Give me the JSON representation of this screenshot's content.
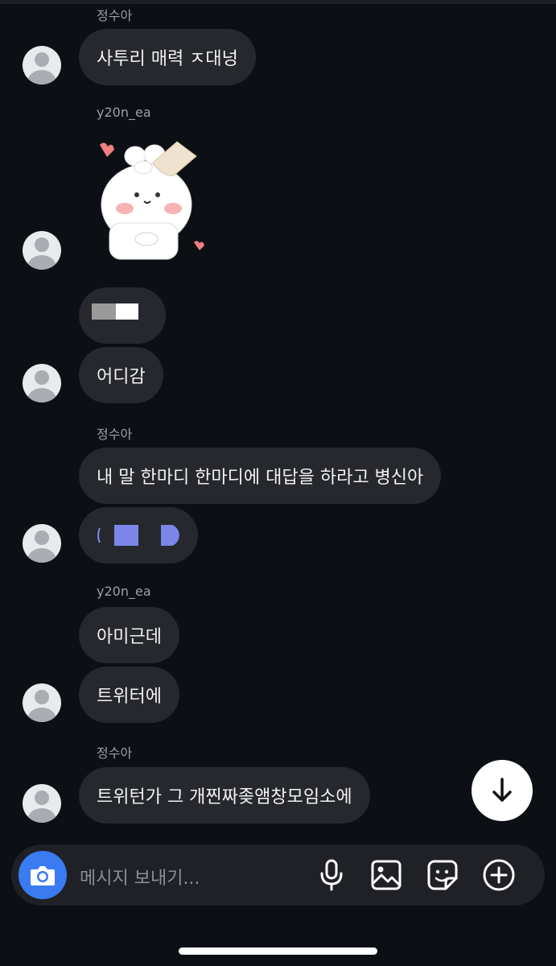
{
  "messages": [
    {
      "sender": "정수아",
      "texts": [
        "사투리 매력 ㅈ대넝"
      ]
    },
    {
      "sender": "y20n_ea",
      "sticker": "bunny-sticker",
      "texts": [
        "어디감"
      ]
    },
    {
      "sender": "정수아",
      "texts": [
        "내 말 한마디 한마디에 대답을 하라고 병신아"
      ]
    },
    {
      "sender": "y20n_ea",
      "texts": [
        "아미근데",
        "트위터에"
      ]
    },
    {
      "sender": "정수아",
      "texts": [
        "트위턴가 그 개찐짜좆앰창모임소에"
      ]
    }
  ],
  "composer": {
    "placeholder": "메시지 보내기..."
  },
  "icons": {
    "camera": "camera-icon",
    "mic": "microphone-icon",
    "gallery": "image-icon",
    "sticker": "sticker-icon",
    "plus": "plus-circle-icon",
    "scroll": "arrow-down-icon"
  },
  "colors": {
    "background": "#0c0f14",
    "bubble": "#26282e",
    "accent": "#3a7bf2",
    "censor_purple": "#7b86e8"
  }
}
